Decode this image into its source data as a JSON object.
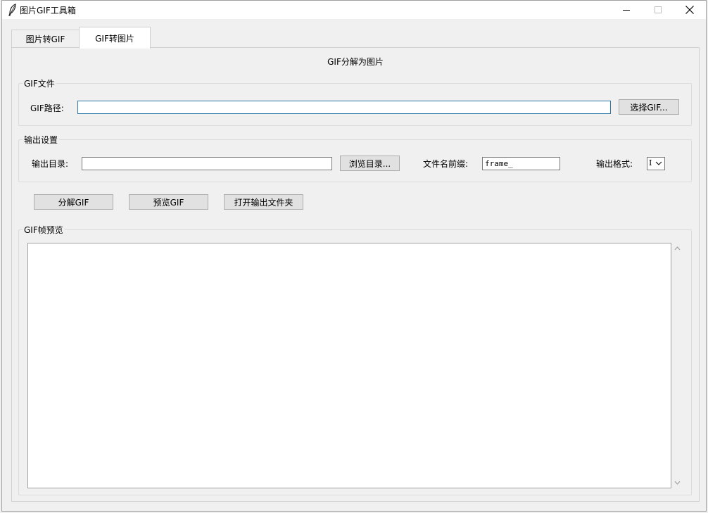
{
  "window": {
    "title": "图片GIF工具箱"
  },
  "tabs": [
    {
      "label": "图片转GIF",
      "active": false
    },
    {
      "label": "GIF转图片",
      "active": true
    }
  ],
  "main": {
    "heading": "GIF分解为图片",
    "gif_file": {
      "group_label": "GIF文件",
      "path_label": "GIF路径:",
      "path_value": "",
      "select_button": "选择GIF..."
    },
    "output": {
      "group_label": "输出设置",
      "dir_label": "输出目录:",
      "dir_value": "",
      "browse_button": "浏览目录...",
      "prefix_label": "文件名前缀:",
      "prefix_value": "frame_",
      "format_label": "输出格式:",
      "format_value": "I"
    },
    "actions": {
      "split_button": "分解GIF",
      "preview_button": "预览GIF",
      "open_folder_button": "打开输出文件夹"
    },
    "preview": {
      "group_label": "GIF帧预览",
      "content": ""
    }
  },
  "colors": {
    "focus_border": "#2b77a8",
    "button_bg": "#e1e1e1",
    "window_bg": "#f0f0f0"
  }
}
